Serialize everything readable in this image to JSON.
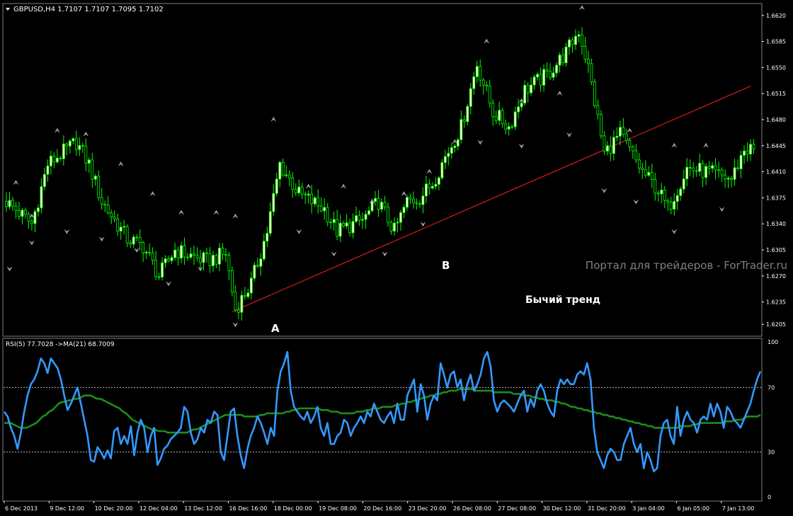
{
  "window": {
    "title_symbol": "GBPUSD,H4",
    "title_ohlc": "1.7107 1.7107 1.7095 1.7102"
  },
  "indicator": {
    "label": "RSI(5) 77.7028  ->MA(21) 68.7009"
  },
  "annotations": {
    "a": "A",
    "b": "B",
    "trend": "Бычий тренд",
    "watermark": "Портал для трейдеров - ForTrader.ru"
  },
  "colors": {
    "background": "#000000",
    "bull": "#ffffcc",
    "bear": "#000000",
    "wick": "#00ff00",
    "trendline": "#ff2020",
    "rsi": "#3399ff",
    "rsi_ma": "#1a8f1a",
    "fractal": "#a0a0a0",
    "axis": "#ffffff",
    "grid_level": "#c0c0c0"
  },
  "chart_data": [
    {
      "type": "candlestick",
      "title": "GBPUSD,H4",
      "ylim": [
        1.619,
        1.6635
      ],
      "y_ticks": [
        "1.6620",
        "1.6585",
        "1.6550",
        "1.6515",
        "1.6480",
        "1.6445",
        "1.6410",
        "1.6375",
        "1.6340",
        "1.6305",
        "1.6270",
        "1.6235",
        "1.6205"
      ],
      "x_ticks": [
        "6 Dec 2013",
        "9 Dec 12:00",
        "10 Dec 20:00",
        "12 Dec 04:00",
        "13 Dec 12:00",
        "16 Dec 16:00",
        "18 Dec 00:00",
        "19 Dec 08:00",
        "20 Dec 16:00",
        "23 Dec 20:00",
        "26 Dec 08:00",
        "27 Dec 08:00",
        "30 Dec 12:00",
        "31 Dec 20:00",
        "3 Jan 04:00",
        "6 Jan 05:00",
        "7 Jan 13:00"
      ],
      "close_path": [
        [
          0,
          1.637
        ],
        [
          8,
          1.634
        ],
        [
          13,
          1.642
        ],
        [
          22,
          1.645
        ],
        [
          26,
          1.642
        ],
        [
          30,
          1.637
        ],
        [
          38,
          1.632
        ],
        [
          43,
          1.631
        ],
        [
          48,
          1.627
        ],
        [
          53,
          1.6305
        ],
        [
          56,
          1.63
        ],
        [
          63,
          1.629
        ],
        [
          69,
          1.63
        ],
        [
          72,
          1.6225
        ],
        [
          77,
          1.626
        ],
        [
          82,
          1.633
        ],
        [
          86,
          1.642
        ],
        [
          92,
          1.638
        ],
        [
          100,
          1.636
        ],
        [
          104,
          1.633
        ],
        [
          112,
          1.6345
        ],
        [
          117,
          1.637
        ],
        [
          122,
          1.633
        ],
        [
          126,
          1.637
        ],
        [
          130,
          1.6375
        ],
        [
          134,
          1.6395
        ],
        [
          138,
          1.643
        ],
        [
          143,
          1.647
        ],
        [
          148,
          1.6555
        ],
        [
          153,
          1.649
        ],
        [
          158,
          1.647
        ],
        [
          163,
          1.652
        ],
        [
          170,
          1.654
        ],
        [
          176,
          1.657
        ],
        [
          180,
          1.66
        ],
        [
          183,
          1.655
        ],
        [
          188,
          1.6435
        ],
        [
          193,
          1.646
        ],
        [
          200,
          1.641
        ],
        [
          205,
          1.6385
        ],
        [
          208,
          1.636
        ],
        [
          214,
          1.6415
        ],
        [
          220,
          1.641
        ],
        [
          228,
          1.64
        ],
        [
          232,
          1.644
        ]
      ],
      "trendline": {
        "from": [
          71,
          1.6222
        ],
        "to": [
          234,
          1.6525
        ]
      },
      "fractals_up": [
        [
          3,
          1.6395
        ],
        [
          8,
          1.635
        ],
        [
          16,
          1.6465
        ],
        [
          25,
          1.646
        ],
        [
          36,
          1.642
        ],
        [
          46,
          1.638
        ],
        [
          55,
          1.6355
        ],
        [
          66,
          1.6355
        ],
        [
          72,
          1.635
        ],
        [
          84,
          1.648
        ],
        [
          95,
          1.639
        ],
        [
          106,
          1.639
        ],
        [
          115,
          1.637
        ],
        [
          125,
          1.638
        ],
        [
          133,
          1.641
        ],
        [
          141,
          1.645
        ],
        [
          151,
          1.6585
        ],
        [
          162,
          1.6505
        ],
        [
          174,
          1.6515
        ],
        [
          181,
          1.663
        ],
        [
          196,
          1.6465
        ],
        [
          210,
          1.6445
        ],
        [
          220,
          1.6445
        ]
      ],
      "fractals_down": [
        [
          1,
          1.628
        ],
        [
          8,
          1.6315
        ],
        [
          19,
          1.633
        ],
        [
          30,
          1.632
        ],
        [
          41,
          1.6305
        ],
        [
          51,
          1.626
        ],
        [
          61,
          1.628
        ],
        [
          72,
          1.6205
        ],
        [
          92,
          1.633
        ],
        [
          103,
          1.63
        ],
        [
          119,
          1.63
        ],
        [
          131,
          1.634
        ],
        [
          149,
          1.645
        ],
        [
          162,
          1.6445
        ],
        [
          177,
          1.646
        ],
        [
          188,
          1.6385
        ],
        [
          198,
          1.637
        ],
        [
          210,
          1.633
        ],
        [
          225,
          1.636
        ]
      ]
    },
    {
      "type": "line",
      "title": "RSI(5) 77.7028  ->MA(21) 68.7009",
      "ylim": [
        0,
        100
      ],
      "y_ticks": [
        "100",
        "70",
        "30",
        "0"
      ],
      "levels": [
        70,
        30
      ],
      "series": [
        {
          "name": "RSI(5)",
          "values": [
            55,
            52,
            45,
            40,
            32,
            42,
            55,
            65,
            72,
            75,
            80,
            88,
            85,
            79,
            88,
            85,
            82,
            75,
            65,
            56,
            60,
            65,
            70,
            60,
            50,
            40,
            25,
            24,
            33,
            30,
            26,
            31,
            26,
            43,
            45,
            35,
            40,
            35,
            46,
            28,
            42,
            50,
            45,
            30,
            40,
            45,
            22,
            26,
            32,
            34,
            38,
            40,
            42,
            45,
            58,
            55,
            42,
            35,
            38,
            45,
            42,
            50,
            48,
            55,
            53,
            30,
            25,
            40,
            55,
            57,
            40,
            28,
            20,
            32,
            40,
            45,
            52,
            48,
            42,
            35,
            45,
            40,
            68,
            80,
            85,
            92,
            68,
            58,
            55,
            52,
            50,
            55,
            48,
            52,
            58,
            45,
            40,
            48,
            35,
            35,
            40,
            42,
            50,
            48,
            40,
            45,
            48,
            52,
            48,
            55,
            52,
            60,
            55,
            50,
            48,
            52,
            55,
            48,
            60,
            50,
            50,
            65,
            70,
            75,
            55,
            72,
            65,
            50,
            60,
            65,
            62,
            85,
            78,
            70,
            78,
            80,
            70,
            75,
            62,
            72,
            78,
            68,
            72,
            78,
            88,
            92,
            83,
            62,
            55,
            60,
            62,
            60,
            58,
            55,
            60,
            65,
            68,
            55,
            63,
            58,
            68,
            72,
            68,
            60,
            55,
            52,
            68,
            75,
            72,
            75,
            72,
            72,
            78,
            80,
            78,
            85,
            75,
            45,
            30,
            25,
            20,
            28,
            32,
            30,
            25,
            25,
            35,
            40,
            45,
            35,
            30,
            35,
            20,
            30,
            25,
            18,
            20,
            40,
            48,
            50,
            40,
            35,
            58,
            40,
            50,
            55,
            50,
            48,
            42,
            50,
            52,
            50,
            60,
            52,
            60,
            55,
            45,
            58,
            55,
            50,
            48,
            45,
            50,
            55,
            60,
            68,
            75,
            80
          ]
        },
        {
          "name": "MA(21)",
          "values": [
            48,
            48,
            48,
            47,
            46,
            45,
            45,
            45,
            46,
            47,
            48,
            50,
            52,
            53,
            55,
            56,
            58,
            60,
            61,
            61,
            62,
            62,
            63,
            63,
            64,
            65,
            65,
            65,
            64,
            63,
            63,
            62,
            61,
            60,
            59,
            58,
            57,
            55,
            54,
            52,
            50,
            49,
            48,
            47,
            46,
            45,
            44,
            44,
            43,
            43,
            43,
            42,
            42,
            42,
            42,
            42,
            42,
            42,
            43,
            44,
            44,
            45,
            46,
            47,
            48,
            49,
            50,
            51,
            52,
            53,
            53,
            53,
            53,
            53,
            53,
            52,
            52,
            52,
            52,
            52,
            53,
            53,
            54,
            54,
            54,
            54,
            54,
            54,
            55,
            55,
            56,
            56,
            57,
            57,
            57,
            57,
            57,
            57,
            57,
            56,
            56,
            56,
            55,
            55,
            55,
            54,
            54,
            54,
            54,
            54,
            55,
            55,
            55,
            56,
            56,
            57,
            57,
            57,
            58,
            58,
            58,
            58,
            59,
            59,
            60,
            60,
            61,
            61,
            62,
            62,
            63,
            64,
            64,
            65,
            65,
            66,
            66,
            67,
            67,
            68,
            68,
            68,
            69,
            69,
            69,
            69,
            69,
            68,
            68,
            68,
            68,
            68,
            68,
            67,
            67,
            67,
            67,
            67,
            67,
            66,
            66,
            66,
            65,
            65,
            65,
            64,
            64,
            63,
            63,
            62,
            62,
            62,
            61,
            61,
            60,
            60,
            59,
            58,
            58,
            57,
            57,
            56,
            56,
            55,
            55,
            54,
            54,
            53,
            53,
            52,
            52,
            51,
            51,
            50,
            50,
            49,
            49,
            48,
            48,
            47,
            47,
            46,
            46,
            45,
            45,
            45,
            45,
            45,
            45,
            45,
            45,
            46,
            46,
            46,
            46,
            47,
            47,
            48,
            48,
            48,
            48,
            48,
            48,
            48,
            48,
            49,
            49,
            49,
            50,
            50,
            50,
            51,
            52,
            52,
            52,
            52,
            53
          ]
        }
      ]
    }
  ]
}
